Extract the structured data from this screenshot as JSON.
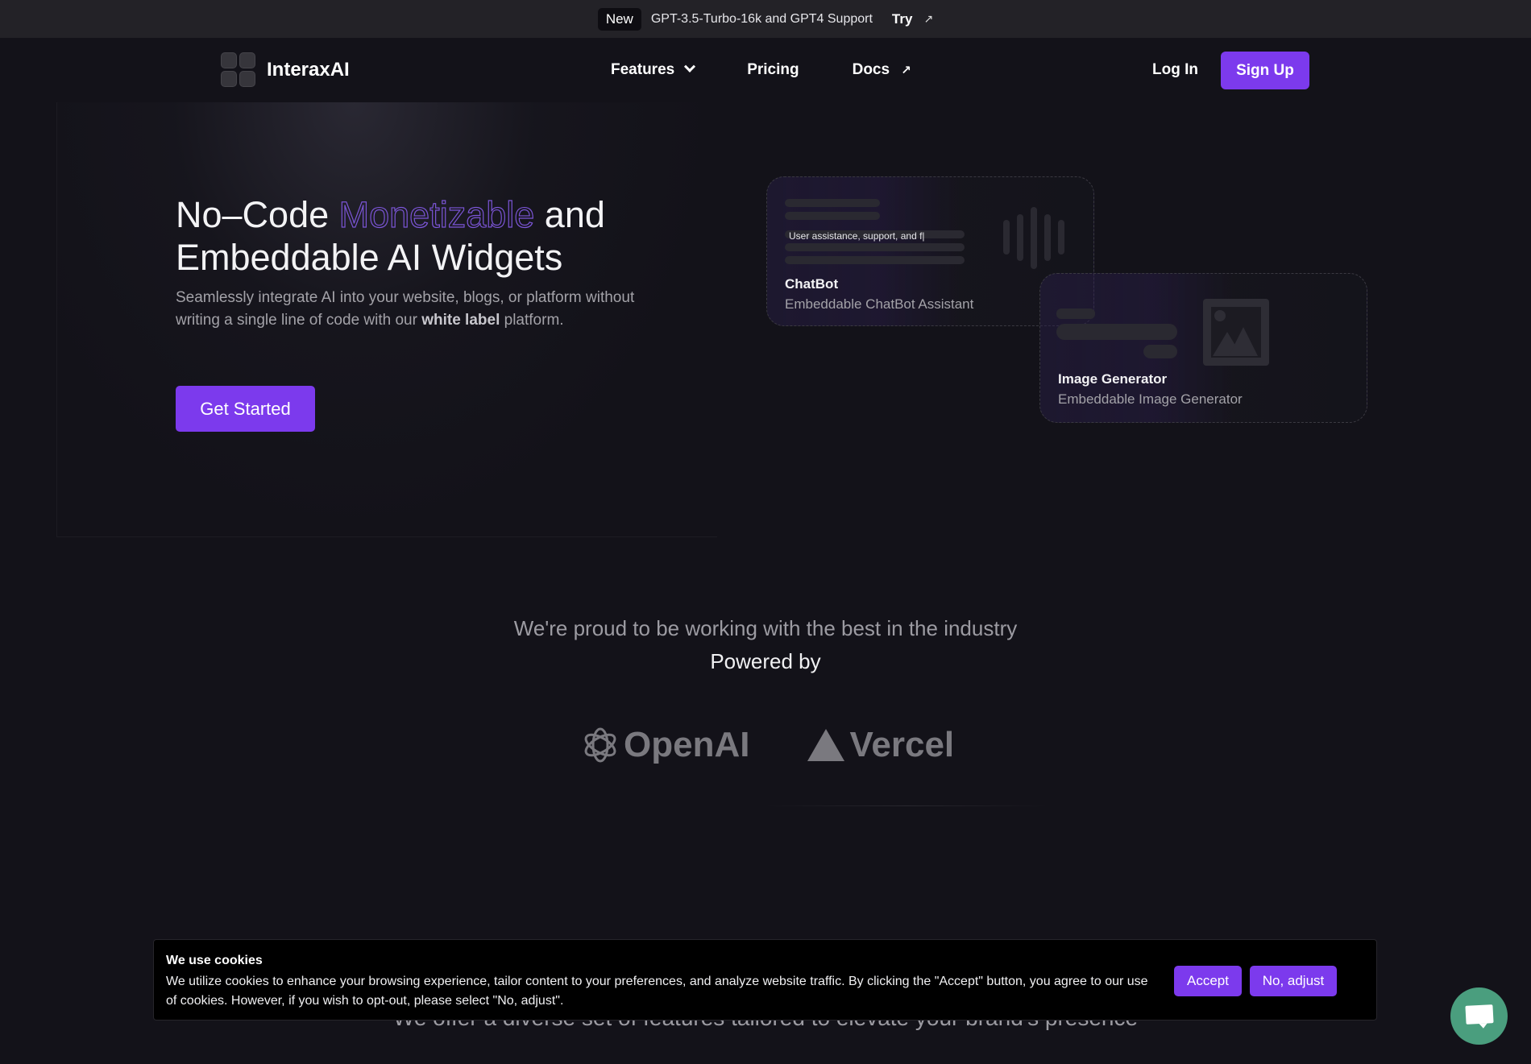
{
  "announcement": {
    "badge": "New",
    "message": "GPT-3.5-Turbo-16k and GPT4 Support",
    "cta": "Try",
    "cta_icon": "arrow-up-right-icon"
  },
  "nav": {
    "brand": "InteraxAI",
    "links": [
      {
        "label": "Features",
        "icon": "chevron-down-icon"
      },
      {
        "label": "Pricing"
      },
      {
        "label": "Docs",
        "icon": "arrow-up-right-icon"
      }
    ],
    "login": "Log In",
    "signup": "Sign Up"
  },
  "hero": {
    "title_part1": "No–Code ",
    "title_highlight": "Monetizable",
    "title_part2": " and Embeddable AI Widgets",
    "subtitle_part1": "Seamlessly integrate AI into your website, blogs, or platform without writing a single line of code with our ",
    "subtitle_bold": "white label",
    "subtitle_part2": " platform.",
    "cta": "Get Started"
  },
  "widgets": [
    {
      "title": "ChatBot",
      "description": "Embeddable ChatBot Assistant",
      "typed_text": "User assistance, support, and f|"
    },
    {
      "title": "Image Generator",
      "description": "Embeddable Image Generator"
    }
  ],
  "partners": {
    "heading": "We're proud to be working with the best in the industry",
    "subheading": "Powered by",
    "logos": [
      "OpenAI",
      "Vercel"
    ]
  },
  "features_heading": "We offer a diverse set of features tailored to elevate your brand's presence",
  "cookie_banner": {
    "title": "We use cookies",
    "text": "We utilize cookies to enhance your browsing experience, tailor content to your preferences, and analyze website traffic. By clicking the \"Accept\" button, you agree to our use of cookies. However, if you wish to opt-out, please select \"No, adjust\".",
    "accept": "Accept",
    "adjust": "No, adjust"
  },
  "colors": {
    "accent": "#7c3aed",
    "background": "#131219",
    "chat_fab": "#4a9e7e"
  }
}
